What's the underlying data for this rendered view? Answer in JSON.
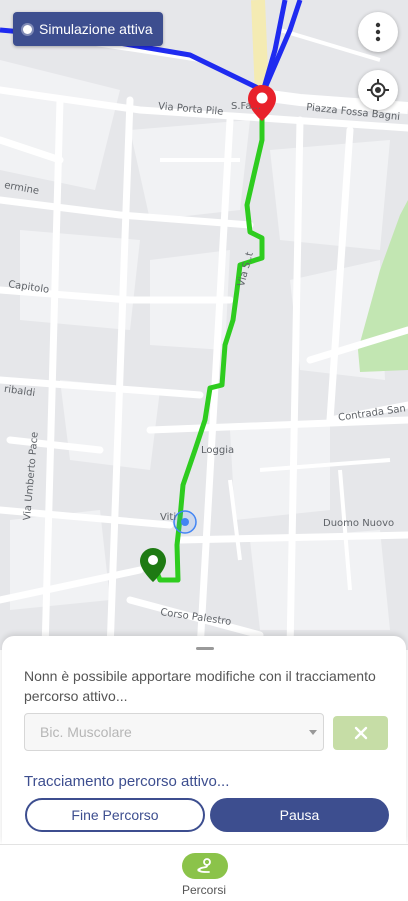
{
  "map": {
    "simulation_chip": "Simulazione attiva",
    "labels": [
      "Via Porta Pile",
      "Piazza Fossa Bagni",
      "Contrada San",
      "Duomo Nuovo",
      "Loggia",
      "Via Umberto Pace",
      "Corso Palestro",
      "Capitolo",
      "Viti",
      "S.Fa...",
      "Via S..t",
      "ermine",
      "ribaldi",
      "Nuovo"
    ],
    "colors": {
      "route": "#2ecc1f",
      "track": "#1f2bf0",
      "destination_pin": "#e8212b",
      "origin_pin": "#1e7a13"
    }
  },
  "sheet": {
    "notice": "Nonn è possibile apportare modifiche con il tracciamento percorso attivo...",
    "vehicle_select": {
      "value": "Bic. Muscolare"
    },
    "tracking_status": "Tracciamento percorso attivo...",
    "end_button": "Fine Percorso",
    "pause_button": "Pausa"
  },
  "bottom_nav": {
    "items": [
      {
        "label": "Percorsi",
        "icon": "route-icon"
      }
    ]
  }
}
